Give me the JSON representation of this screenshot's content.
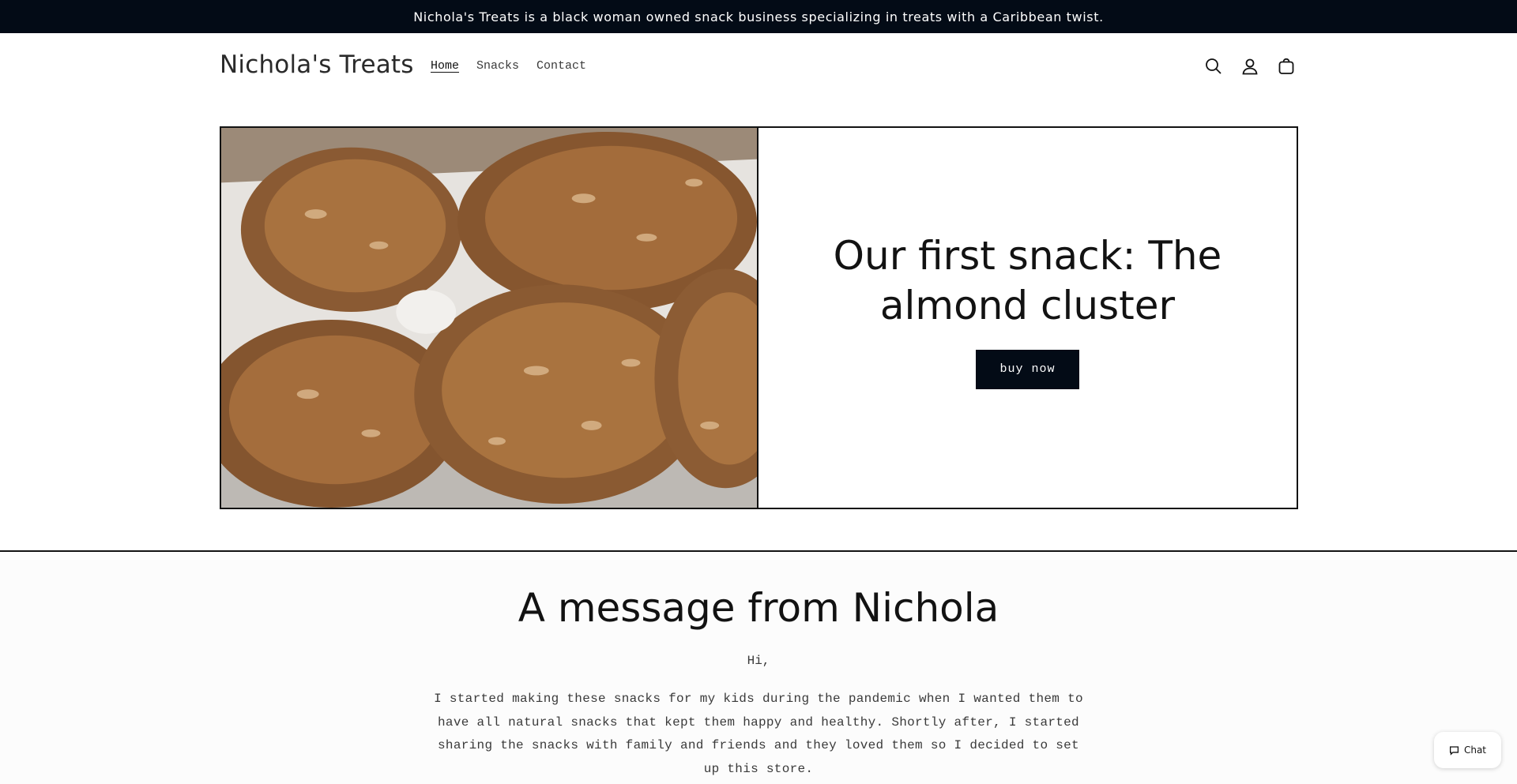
{
  "announcement": {
    "text": "Nichola's Treats is a black woman owned snack business specializing in treats with a Caribbean twist."
  },
  "header": {
    "logo": "Nichola's Treats",
    "nav": [
      {
        "label": "Home",
        "active": true
      },
      {
        "label": "Snacks",
        "active": false
      },
      {
        "label": "Contact",
        "active": false
      }
    ],
    "icons": [
      "search-icon",
      "account-icon",
      "cart-icon"
    ]
  },
  "hero": {
    "title": "Our first snack: The almond cluster",
    "button_label": "buy now"
  },
  "message": {
    "title": "A message from Nichola",
    "greeting": "Hi,",
    "body": "I started making these snacks for my kids during the pandemic when I wanted them to have all natural snacks that kept them happy and healthy. Shortly after, I started sharing the snacks with family and friends and they loved them so I decided to set up this store."
  },
  "chat": {
    "label": "Chat"
  },
  "colors": {
    "announcement_bg": "#030b16",
    "button_bg": "#030b16",
    "text": "#121212"
  }
}
